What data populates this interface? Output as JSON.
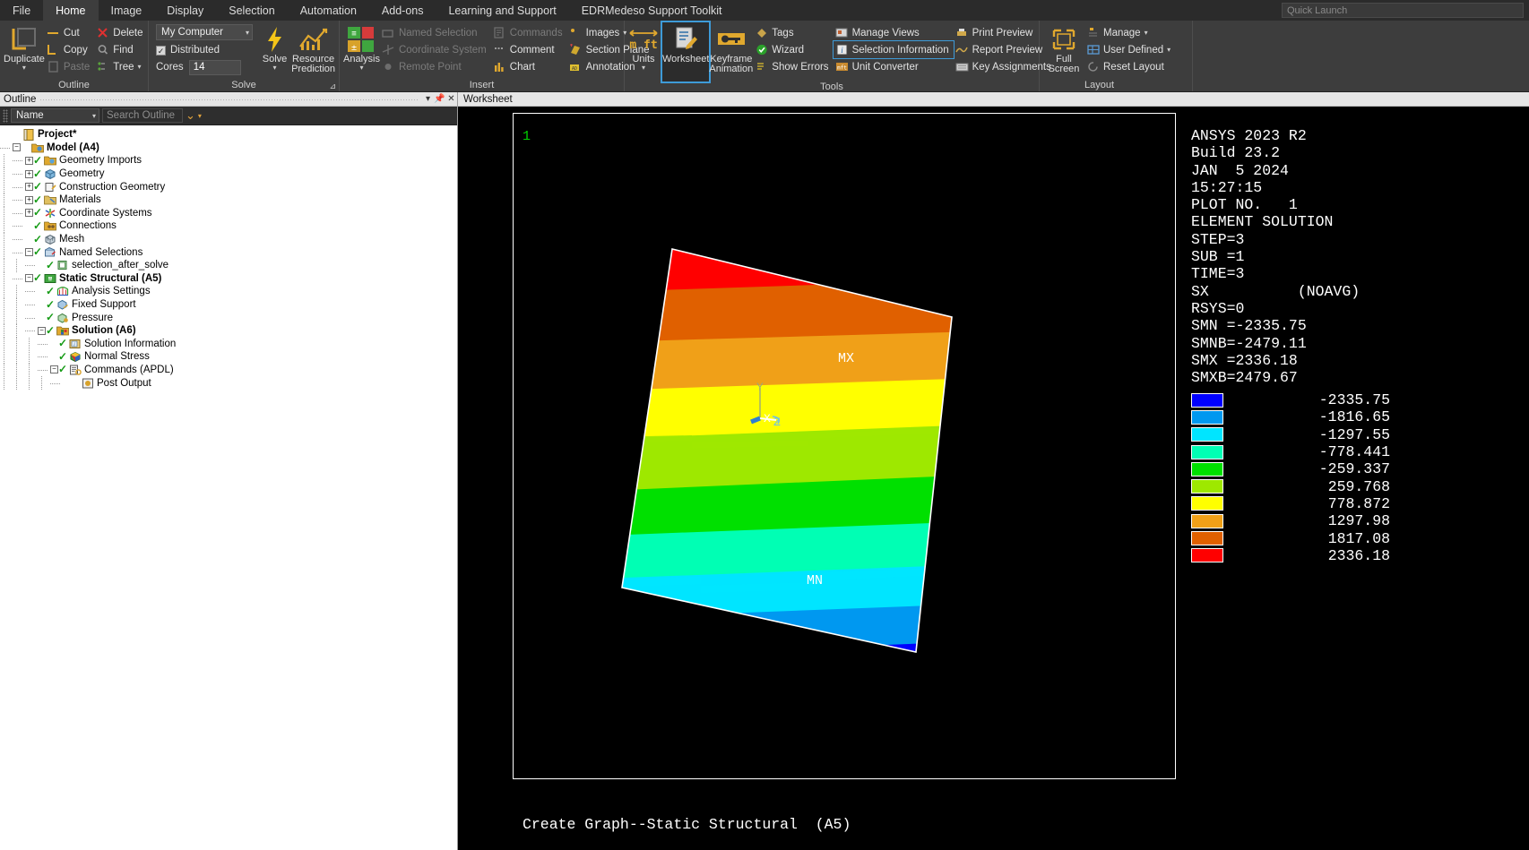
{
  "menubar": {
    "items": [
      {
        "label": "File",
        "active": false
      },
      {
        "label": "Home",
        "active": true
      },
      {
        "label": "Image",
        "active": false
      },
      {
        "label": "Display",
        "active": false
      },
      {
        "label": "Selection",
        "active": false
      },
      {
        "label": "Automation",
        "active": false
      },
      {
        "label": "Add-ons",
        "active": false
      },
      {
        "label": "Learning and Support",
        "active": false
      },
      {
        "label": "EDRMedeso Support Toolkit",
        "active": false
      }
    ],
    "quick_launch_placeholder": "Quick Launch"
  },
  "ribbon": {
    "outline_group": {
      "label": "Outline",
      "duplicate_label": "Duplicate",
      "cut_label": "Cut",
      "copy_label": "Copy",
      "paste_label": "Paste",
      "delete_label": "Delete",
      "find_label": "Find",
      "tree_label": "Tree"
    },
    "solve_group": {
      "label": "Solve",
      "computer_value": "My Computer",
      "distributed_label": "Distributed",
      "distributed_checked": "✓",
      "cores_label": "Cores",
      "cores_value": "14",
      "solve_label": "Solve",
      "resource_prediction_label": "Resource Prediction"
    },
    "insert_group": {
      "label": "Insert",
      "analysis_label": "Analysis",
      "named_selection_label": "Named Selection",
      "coordinate_system_label": "Coordinate System",
      "remote_point_label": "Remote Point",
      "commands_label": "Commands",
      "comment_label": "Comment",
      "chart_label": "Chart",
      "images_label": "Images",
      "section_plane_label": "Section Plane",
      "annotation_label": "Annotation"
    },
    "tools_group": {
      "label": "Tools",
      "units_label": "Units",
      "worksheet_label": "Worksheet",
      "keyframe_animation_label": "Keyframe Animation",
      "tags_label": "Tags",
      "wizard_label": "Wizard",
      "show_errors_label": "Show Errors",
      "manage_views_label": "Manage Views",
      "selection_information_label": "Selection Information",
      "unit_converter_label": "Unit Converter",
      "print_preview_label": "Print Preview",
      "report_preview_label": "Report Preview",
      "key_assignments_label": "Key Assignments"
    },
    "layout_group": {
      "label": "Layout",
      "full_screen_label": "Full Screen",
      "manage_label": "Manage",
      "user_defined_label": "User Defined",
      "reset_layout_label": "Reset Layout"
    }
  },
  "outline": {
    "title": "Outline",
    "filter_value": "Name",
    "search_placeholder": "Search Outline",
    "tree": [
      {
        "label": "Project*",
        "depth": 0,
        "expander": "",
        "check": false,
        "bold": true,
        "icon": "project-icon"
      },
      {
        "label": "Model (A4)",
        "depth": 1,
        "expander": "−",
        "check": false,
        "bold": true,
        "icon": "model-icon"
      },
      {
        "label": "Geometry Imports",
        "depth": 2,
        "expander": "+",
        "check": true,
        "bold": false,
        "icon": "geometry-imports-icon"
      },
      {
        "label": "Geometry",
        "depth": 2,
        "expander": "+",
        "check": true,
        "bold": false,
        "icon": "geometry-icon"
      },
      {
        "label": "Construction Geometry",
        "depth": 2,
        "expander": "+",
        "check": true,
        "bold": false,
        "icon": "construction-geometry-icon"
      },
      {
        "label": "Materials",
        "depth": 2,
        "expander": "+",
        "check": true,
        "bold": false,
        "icon": "materials-icon"
      },
      {
        "label": "Coordinate Systems",
        "depth": 2,
        "expander": "+",
        "check": true,
        "bold": false,
        "icon": "coordinate-systems-icon"
      },
      {
        "label": "Connections",
        "depth": 2,
        "expander": "",
        "check": true,
        "bold": false,
        "icon": "connections-icon"
      },
      {
        "label": "Mesh",
        "depth": 2,
        "expander": "",
        "check": true,
        "bold": false,
        "icon": "mesh-icon"
      },
      {
        "label": "Named Selections",
        "depth": 2,
        "expander": "−",
        "check": true,
        "bold": false,
        "icon": "named-selections-icon"
      },
      {
        "label": "selection_after_solve",
        "depth": 3,
        "expander": "",
        "check": true,
        "bold": false,
        "icon": "named-selection-item-icon"
      },
      {
        "label": "Static Structural (A5)",
        "depth": 2,
        "expander": "−",
        "check": true,
        "bold": true,
        "icon": "static-structural-icon"
      },
      {
        "label": "Analysis Settings",
        "depth": 3,
        "expander": "",
        "check": true,
        "bold": false,
        "icon": "analysis-settings-icon"
      },
      {
        "label": "Fixed Support",
        "depth": 3,
        "expander": "",
        "check": true,
        "bold": false,
        "icon": "fixed-support-icon"
      },
      {
        "label": "Pressure",
        "depth": 3,
        "expander": "",
        "check": true,
        "bold": false,
        "icon": "pressure-icon"
      },
      {
        "label": "Solution (A6)",
        "depth": 3,
        "expander": "−",
        "check": true,
        "bold": true,
        "icon": "solution-icon"
      },
      {
        "label": "Solution Information",
        "depth": 4,
        "expander": "",
        "check": true,
        "bold": false,
        "icon": "solution-information-icon"
      },
      {
        "label": "Normal Stress",
        "depth": 4,
        "expander": "",
        "check": true,
        "bold": false,
        "icon": "normal-stress-icon"
      },
      {
        "label": "Commands (APDL)",
        "depth": 4,
        "expander": "−",
        "check": true,
        "bold": false,
        "icon": "commands-apdl-icon"
      },
      {
        "label": "Post Output",
        "depth": 5,
        "expander": "",
        "check": false,
        "bold": false,
        "icon": "post-output-icon"
      }
    ]
  },
  "worksheet": {
    "title": "Worksheet",
    "plot_number": "1",
    "footer": "Create Graph--Static Structural  (A5)",
    "mx_label": "MX",
    "mn_label": "MN",
    "axis_x": "X",
    "axis_y": "Y",
    "axis_z": "Z",
    "info_lines": [
      "ANSYS 2023 R2",
      "Build 23.2",
      "JAN  5 2024",
      "15:27:15",
      "PLOT NO.   1",
      "ELEMENT SOLUTION",
      "STEP=3",
      "SUB =1",
      "TIME=3",
      "SX          (NOAVG)",
      "RSYS=0",
      "SMN =-2335.75",
      "SMNB=-2479.11",
      "SMX =2336.18",
      "SMXB=2479.67"
    ],
    "legend": [
      {
        "color": "#0000ff",
        "value": "-2335.75"
      },
      {
        "color": "#0098f0",
        "value": "-1816.65"
      },
      {
        "color": "#00e5ff",
        "value": "-1297.55"
      },
      {
        "color": "#00ffb4",
        "value": "-778.441"
      },
      {
        "color": "#00e000",
        "value": "-259.337"
      },
      {
        "color": "#9ee800",
        "value": "259.768"
      },
      {
        "color": "#ffff00",
        "value": "778.872"
      },
      {
        "color": "#f0a018",
        "value": "1297.98"
      },
      {
        "color": "#e06000",
        "value": "1817.08"
      },
      {
        "color": "#ff0000",
        "value": "2336.18"
      }
    ]
  },
  "colors": {
    "accent": "#3e9bd8",
    "ribbon_bg": "#3d3d3d",
    "panel_bg": "#ffffff",
    "graphics_bg": "#000000",
    "gold": "#e2a33c"
  }
}
